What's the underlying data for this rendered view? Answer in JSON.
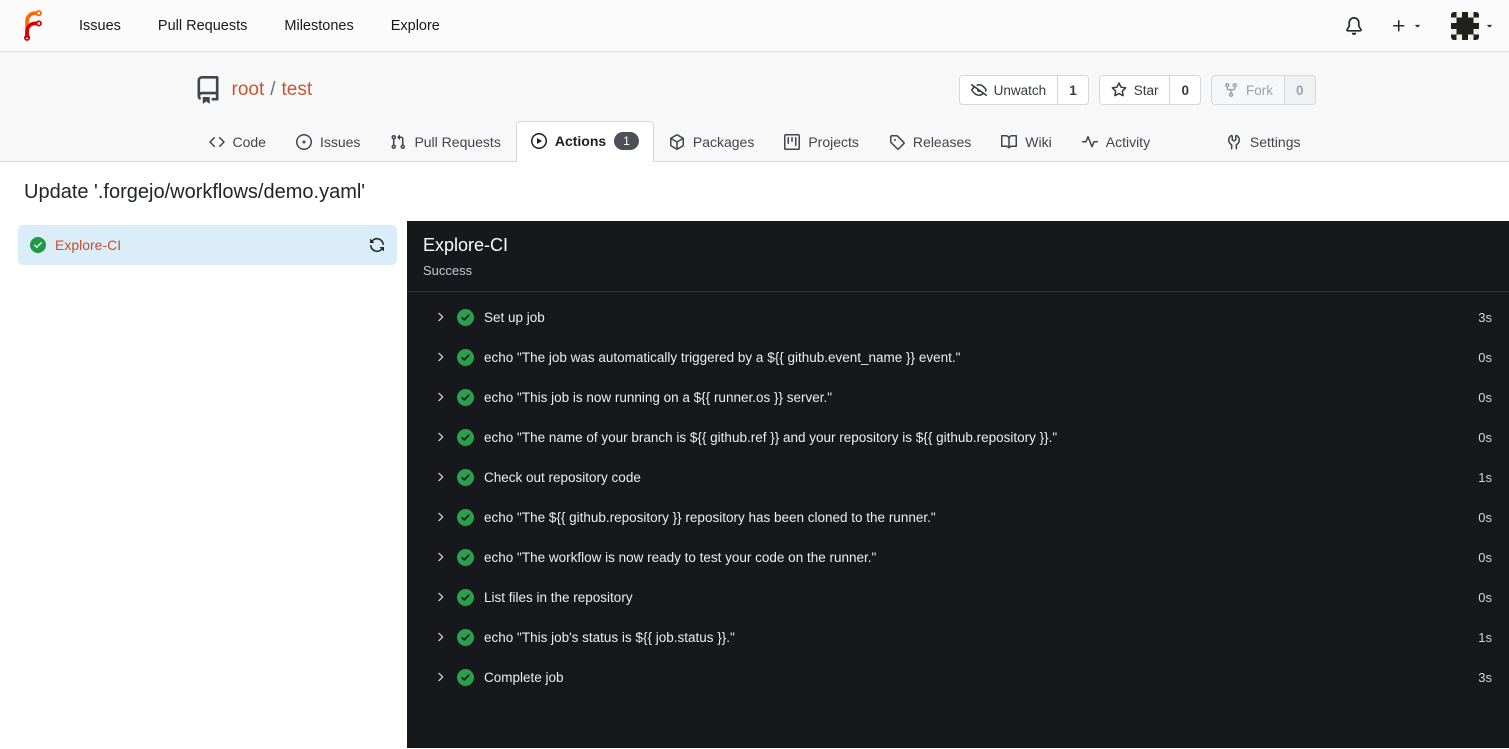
{
  "navbar": {
    "links": [
      {
        "label": "Issues",
        "icon": "none"
      },
      {
        "label": "Pull Requests",
        "icon": "none"
      },
      {
        "label": "Milestones",
        "icon": "none"
      },
      {
        "label": "Explore",
        "icon": "none"
      }
    ],
    "right": {
      "notifications_icon": "bell-icon",
      "create_icon": "plus-icon",
      "user_avatar": "identicon"
    }
  },
  "repo": {
    "owner": "root",
    "separator": "/",
    "name": "test",
    "buttons": [
      {
        "label": "Unwatch",
        "count": "1",
        "icon": "eye-closed-icon",
        "disabled": false
      },
      {
        "label": "Star",
        "count": "0",
        "icon": "star-icon",
        "disabled": false
      },
      {
        "label": "Fork",
        "count": "0",
        "icon": "fork-icon",
        "disabled": true
      }
    ],
    "tabs": [
      {
        "label": "Code",
        "icon": "code-icon",
        "active": false
      },
      {
        "label": "Issues",
        "icon": "issue-icon",
        "active": false
      },
      {
        "label": "Pull Requests",
        "icon": "pull-request-icon",
        "active": false
      },
      {
        "label": "Actions",
        "icon": "play-circle-icon",
        "active": true,
        "badge": "1"
      },
      {
        "label": "Packages",
        "icon": "package-icon",
        "active": false
      },
      {
        "label": "Projects",
        "icon": "project-board-icon",
        "active": false
      },
      {
        "label": "Releases",
        "icon": "tag-icon",
        "active": false
      },
      {
        "label": "Wiki",
        "icon": "book-icon",
        "active": false
      },
      {
        "label": "Activity",
        "icon": "pulse-icon",
        "active": false
      },
      {
        "label": "Settings",
        "icon": "tools-icon",
        "active": false
      }
    ]
  },
  "run": {
    "title": "Update '.forgejo/workflows/demo.yaml'",
    "job": {
      "name": "Explore-CI",
      "status": "Success",
      "status_icon": "check-circle-icon",
      "rerun_icon": "sync-icon"
    },
    "steps": [
      {
        "name": "Set up job",
        "duration": "3s",
        "status_icon": "check-circle-icon"
      },
      {
        "name": "echo \"The job was automatically triggered by a ${{ github.event_name }} event.\"",
        "duration": "0s",
        "status_icon": "check-circle-icon"
      },
      {
        "name": "echo \"This job is now running on a ${{ runner.os }} server.\"",
        "duration": "0s",
        "status_icon": "check-circle-icon"
      },
      {
        "name": "echo \"The name of your branch is ${{ github.ref }} and your repository is ${{ github.repository }}.\"",
        "duration": "0s",
        "status_icon": "check-circle-icon"
      },
      {
        "name": "Check out repository code",
        "duration": "1s",
        "status_icon": "check-circle-icon"
      },
      {
        "name": "echo \"The ${{ github.repository }} repository has been cloned to the runner.\"",
        "duration": "0s",
        "status_icon": "check-circle-icon"
      },
      {
        "name": "echo \"The workflow is now ready to test your code on the runner.\"",
        "duration": "0s",
        "status_icon": "check-circle-icon"
      },
      {
        "name": "List files in the repository",
        "duration": "0s",
        "status_icon": "check-circle-icon"
      },
      {
        "name": "echo \"This job's status is ${{ job.status }}.\"",
        "duration": "1s",
        "status_icon": "check-circle-icon"
      },
      {
        "name": "Complete job",
        "duration": "3s",
        "status_icon": "check-circle-icon"
      }
    ]
  },
  "colors": {
    "accent_link": "#c9572d",
    "success_green": "#229a44",
    "log_panel_bg": "#17181c",
    "selected_job_bg": "#dbedf9",
    "header_bg": "#f8f8f8",
    "badge_bg": "#4c5158"
  }
}
